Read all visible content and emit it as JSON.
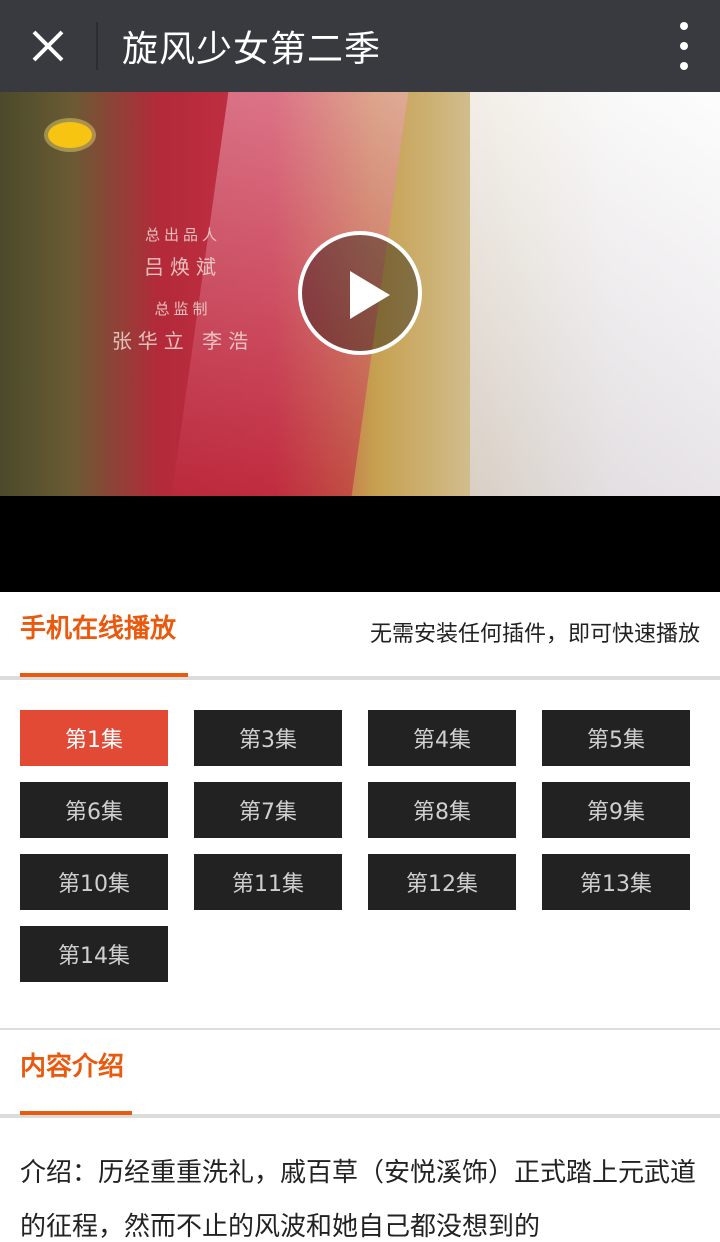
{
  "app": {
    "title": "旋风少女第二季"
  },
  "video": {
    "credits": [
      "总出品人",
      "吕焕斌",
      "总监制",
      "张华立 李浩"
    ]
  },
  "online": {
    "heading": "手机在线播放",
    "subtitle": "无需安装任何插件，即可快速播放",
    "accent_color": "#e95a0f",
    "episodes": [
      {
        "label": "第1集",
        "active": true
      },
      {
        "label": "第3集",
        "active": false
      },
      {
        "label": "第4集",
        "active": false
      },
      {
        "label": "第5集",
        "active": false
      },
      {
        "label": "第6集",
        "active": false
      },
      {
        "label": "第7集",
        "active": false
      },
      {
        "label": "第8集",
        "active": false
      },
      {
        "label": "第9集",
        "active": false
      },
      {
        "label": "第10集",
        "active": false
      },
      {
        "label": "第11集",
        "active": false
      },
      {
        "label": "第12集",
        "active": false
      },
      {
        "label": "第13集",
        "active": false
      },
      {
        "label": "第14集",
        "active": false
      }
    ]
  },
  "intro": {
    "heading": "内容介绍",
    "text": "介绍：历经重重洗礼，戚百草（安悦溪饰）正式踏上元武道的征程，然而不止的风波和她自己都没想到的"
  },
  "icons": {
    "close": "close-icon",
    "more": "more-vertical-icon",
    "play": "play-icon"
  }
}
